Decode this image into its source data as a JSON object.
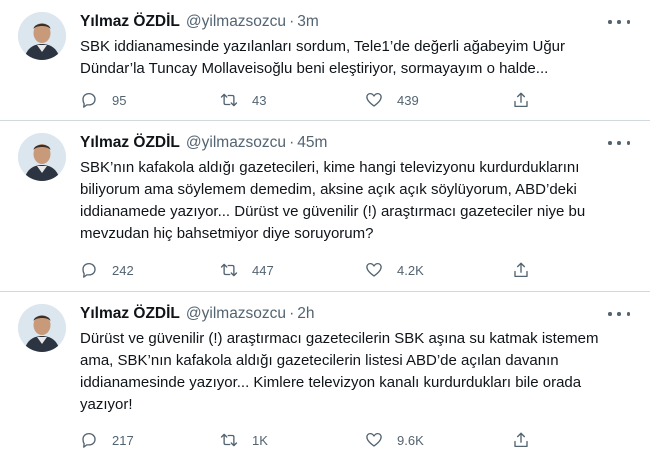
{
  "tweets": [
    {
      "name": "Yılmaz ÖZDİL",
      "handle": "@yilmazsozcu",
      "dot": "·",
      "time": "3m",
      "text": "SBK iddianamesinde yazılanları sordum, Tele1’de değerli ağabeyim Uğur\nDündar’la Tuncay Mollaveisoğlu beni eleştiriyor, sormayayım o halde...",
      "replies": "95",
      "retweets": "43",
      "likes": "439"
    },
    {
      "name": "Yılmaz ÖZDİL",
      "handle": "@yilmazsozcu",
      "dot": "·",
      "time": "45m",
      "text": "SBK’nın kafakola aldığı gazetecileri, kime hangi televizyonu kurdurduklarını\nbiliyorum ama söylemem demedim, aksine açık açık söylüyorum, ABD’deki\niddianamede yazıyor... Dürüst ve güvenilir (!) araştırmacı gazeteciler niye bu\nmevzudan hiç bahsetmiyor diye soruyorum?",
      "replies": "242",
      "retweets": "447",
      "likes": "4.2K"
    },
    {
      "name": "Yılmaz ÖZDİL",
      "handle": "@yilmazsozcu",
      "dot": "·",
      "time": "2h",
      "text": "Dürüst ve güvenilir (!) araştırmacı gazetecilerin SBK aşına su katmak istemem\nama, SBK’nın kafakola aldığı gazetecilerin listesi ABD’de açılan davanın\niddianamesinde yazıyor... Kimlere televizyon kanalı kurdurdukları bile orada\nyazıyor!",
      "replies": "217",
      "retweets": "1K",
      "likes": "9.6K"
    }
  ],
  "icons": {
    "reply": "reply-icon",
    "retweet": "retweet-icon",
    "like": "heart-icon",
    "share": "share-icon",
    "more": "more-icon"
  },
  "colors": {
    "text": "#0f1419",
    "secondary": "#536471",
    "divider": "#cfd9de",
    "background": "#ffffff"
  }
}
